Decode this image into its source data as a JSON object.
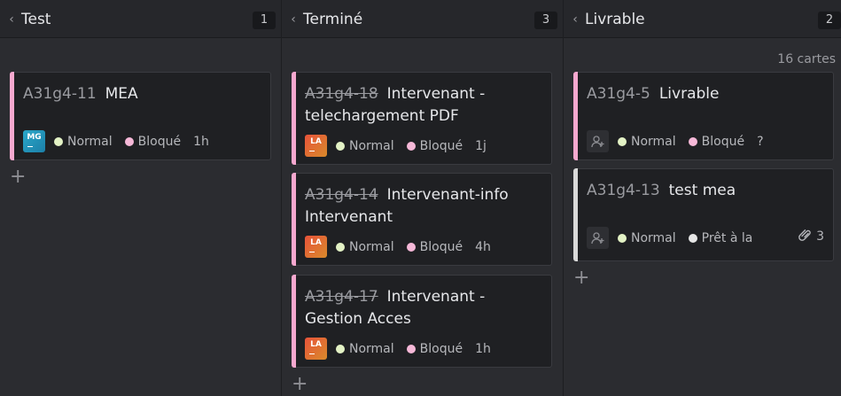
{
  "board": {
    "cards_count": "16 cartes",
    "columns": [
      {
        "title": "Test",
        "count": "1"
      },
      {
        "title": "Terminé",
        "count": "3"
      },
      {
        "title": "Livrable",
        "count": "2"
      }
    ]
  },
  "cards": {
    "c1": {
      "key": "A31g4-11",
      "title": "MEA",
      "avatar": "MG",
      "priority": "Normal",
      "status": "Bloqué",
      "time": "1h"
    },
    "c2": {
      "key": "A31g4-18",
      "title": "Intervenant -",
      "title2": "telechargement PDF",
      "avatar": "LA",
      "priority": "Normal",
      "status": "Bloqué",
      "time": "1j"
    },
    "c3": {
      "key": "A31g4-14",
      "title": "Intervenant-info",
      "title2": "Intervenant",
      "avatar": "LA",
      "priority": "Normal",
      "status": "Bloqué",
      "time": "4h"
    },
    "c4": {
      "key": "A31g4-17",
      "title": "Intervenant -",
      "title2": "Gestion Acces",
      "avatar": "LA",
      "priority": "Normal",
      "status": "Bloqué",
      "time": "1h"
    },
    "c5": {
      "key": "A31g4-5",
      "title": "Livrable",
      "priority": "Normal",
      "status": "Bloqué",
      "time": "?"
    },
    "c6": {
      "key": "A31g4-13",
      "title": "test mea",
      "priority": "Normal",
      "status": "Prêt à la",
      "attachments": "3"
    }
  },
  "colors": {
    "blocked_stripe": "#f6a8cf",
    "ready_stripe": "#d9d9d9",
    "normal_dot": "#e3f2c5",
    "blocked_dot": "#f6b8d8",
    "ready_dot": "#e6e6e6"
  },
  "icons": {
    "collapse": "chevron-left-icon",
    "add": "plus-icon",
    "unassigned": "add-person-icon",
    "attachment": "paperclip-icon"
  }
}
